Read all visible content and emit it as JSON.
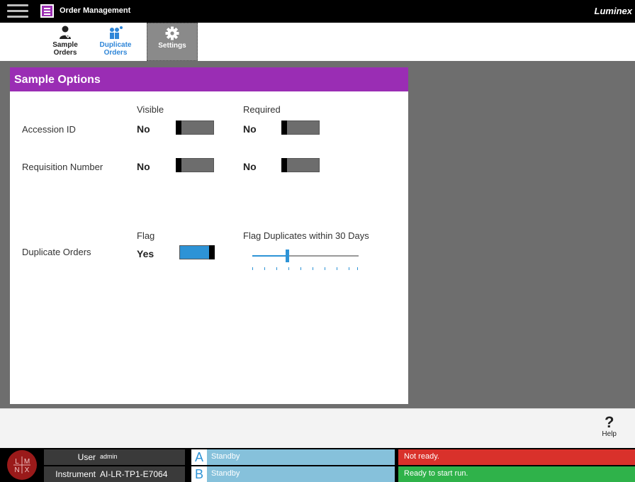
{
  "header": {
    "app_title": "Order Management",
    "brand": "Luminex"
  },
  "tabs": [
    {
      "label_line1": "Sample",
      "label_line2": "Orders"
    },
    {
      "label_line1": "Duplicate",
      "label_line2": "Orders"
    },
    {
      "label_line1": "Settings"
    }
  ],
  "sample_options": {
    "title": "Sample Options",
    "col_visible": "Visible",
    "col_required": "Required",
    "rows": [
      {
        "label": "Accession ID",
        "visible": "No",
        "required": "No"
      },
      {
        "label": "Requisition Number",
        "visible": "No",
        "required": "No"
      }
    ],
    "duplicates": {
      "label": "Duplicate Orders",
      "flag_header": "Flag",
      "flag_value": "Yes",
      "within_header": "Flag Duplicates within 30 Days",
      "slider_days": 30
    }
  },
  "help": {
    "glyph": "?",
    "label": "Help"
  },
  "status": {
    "user_key": "User",
    "user_value": "admin",
    "instrument_key": "Instrument",
    "instrument_value": "AI-LR-TP1-E7064",
    "slot_a_letter": "A",
    "slot_a_status": "Standby",
    "slot_b_letter": "B",
    "slot_b_status": "Standby",
    "system_status_1": "Not ready.",
    "system_status_2": "Ready to start run.",
    "colors": {
      "not_ready": "#d9312b",
      "ready": "#2fb24a",
      "accent": "#9a2db4",
      "slot": "#86c1db"
    }
  }
}
